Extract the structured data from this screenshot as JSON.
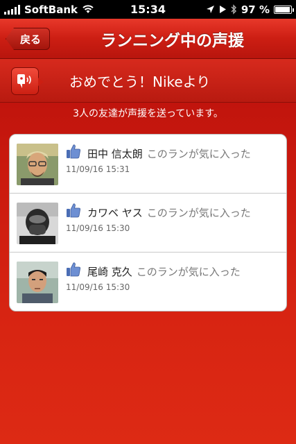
{
  "status_bar": {
    "carrier": "SoftBank",
    "time": "15:34",
    "battery": "97 %",
    "battery_level": 0.97
  },
  "nav": {
    "back_label": "戻る",
    "title": "ランニング中の声援"
  },
  "banner": {
    "icon": "cheer-speaker-icon",
    "text": "おめでとう！Nikeより"
  },
  "subtitle": "3人の友達が声援を送っています。",
  "colors": {
    "accent": "#c8180e",
    "like_blue": "#4a6db5"
  },
  "cheers": [
    {
      "name": "田中 信太朗",
      "action": "このランが気に入った",
      "time": "11/09/16 15:31",
      "avatar": "avatar-glasses-man"
    },
    {
      "name": "カワベ ヤス",
      "action": "このランが気に入った",
      "time": "11/09/16 15:30",
      "avatar": "avatar-masked-man"
    },
    {
      "name": "尾崎 克久",
      "action": "このランが気に入った",
      "time": "11/09/16 15:30",
      "avatar": "avatar-man-portrait"
    }
  ]
}
